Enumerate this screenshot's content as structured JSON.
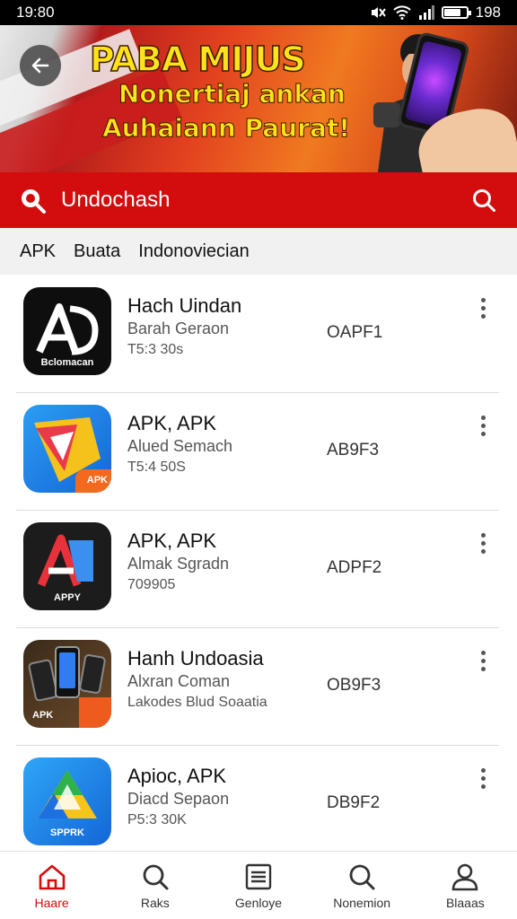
{
  "status_bar": {
    "time": "19:80",
    "battery": "198",
    "battery_level": 0.75
  },
  "banner": {
    "line1": "PABA MIJUS",
    "line2": "Nonertiaj ankan",
    "line3": "Auhaiann Paurat!"
  },
  "search": {
    "query": "Undochash"
  },
  "tabs": [
    "APK",
    "Buata",
    "Indonoviecian"
  ],
  "apps": [
    {
      "title": "Hach Uindan",
      "sub1": "Barah Geraon",
      "sub2": "T5:3 30s",
      "code": "OAPF1",
      "icon_label": "Bclomacan",
      "icon": "a-logo-icon"
    },
    {
      "title": "APK, APK",
      "sub1": "Alued Semach",
      "sub2": "T5:4 50S",
      "code": "AB9F3",
      "icon_label": "APK",
      "icon": "folder-arrow-icon"
    },
    {
      "title": "APK, APK",
      "sub1": "Almak Sgradn",
      "sub2": "709905",
      "code": "ADPF2",
      "icon_label": "APPY",
      "icon": "apk-a-icon"
    },
    {
      "title": "Hanh Undoasia",
      "sub1": "Alxran Coman",
      "sub2": "Lakodes Blud Soaatia",
      "code": "OB9F3",
      "icon_label": "APK",
      "icon": "phones-icon"
    },
    {
      "title": "Apioc, APK",
      "sub1": "Diacd Sepaon",
      "sub2": "P5:3 30K",
      "code": "DB9F2",
      "icon_label": "SPPRK",
      "icon": "triangle-logo-icon"
    }
  ],
  "bottom_nav": [
    {
      "label": "Haare",
      "icon": "home-icon",
      "active": true
    },
    {
      "label": "Raks",
      "icon": "search-icon",
      "active": false
    },
    {
      "label": "Genloye",
      "icon": "list-icon",
      "active": false
    },
    {
      "label": "Nonemion",
      "icon": "search-icon",
      "active": false
    },
    {
      "label": "Blaaas",
      "icon": "profile-icon",
      "active": false
    }
  ],
  "colors": {
    "accent": "#d30d0d",
    "banner_text": "#ffe21a"
  }
}
